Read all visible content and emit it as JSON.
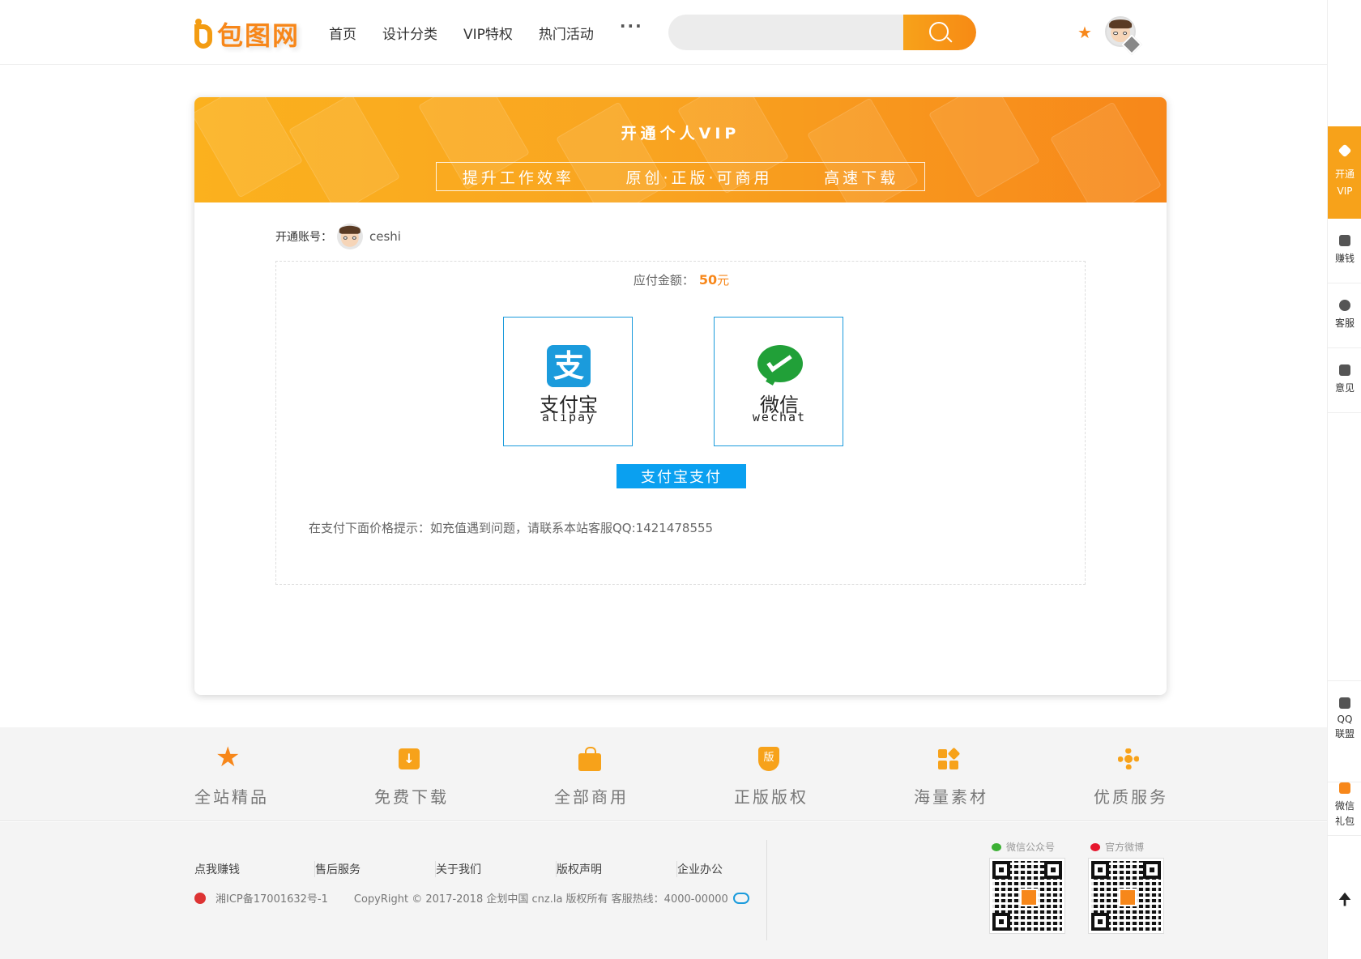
{
  "header": {
    "logo_text": "包图网",
    "nav": [
      "首页",
      "设计分类",
      "VIP特权",
      "热门活动"
    ],
    "more": "···",
    "search_placeholder": ""
  },
  "banner": {
    "title": "开通个人VIP",
    "features": [
      "提升工作效率",
      "原创·正版·可商用",
      "高速下载"
    ]
  },
  "account": {
    "label": "开通账号：",
    "name": "ceshi"
  },
  "payment": {
    "amount_label": "应付金额：",
    "amount_value": "50",
    "amount_unit": "元",
    "alipay": {
      "cn": "支付宝",
      "en": "alipay",
      "glyph": "支"
    },
    "wechat": {
      "cn": "微信",
      "en": "wechat"
    },
    "pay_button": "支付宝支付",
    "tip": "在支付下面价格提示：如充值遇到问题，请联系本站客服QQ:1421478555"
  },
  "features": [
    "全站精品",
    "免费下载",
    "全部商用",
    "正版版权",
    "海量素材",
    "优质服务"
  ],
  "feature_shield_glyph": "版",
  "footer": {
    "links": [
      "点我赚钱",
      "售后服务",
      "关于我们",
      "版权声明",
      "企业办公"
    ],
    "icp": "湘ICP备17001632号-1",
    "copyright": "CopyRight © 2017-2018 企划中国 cnz.la 版权所有 客服热线：4000-00000",
    "qr_wechat_label": "微信公众号",
    "qr_weibo_label": "官方微博"
  },
  "sidebar": {
    "vip": [
      "开通",
      "VIP"
    ],
    "earn": "赚钱",
    "service": "客服",
    "feedback": "意见",
    "qq": [
      "QQ",
      "联盟"
    ],
    "gift": [
      "微信",
      "礼包"
    ],
    "top": "🠉"
  },
  "colors": {
    "accent": "#f7871a",
    "pay_blue": "#0aa0f0",
    "wechat_green": "#21a038"
  }
}
